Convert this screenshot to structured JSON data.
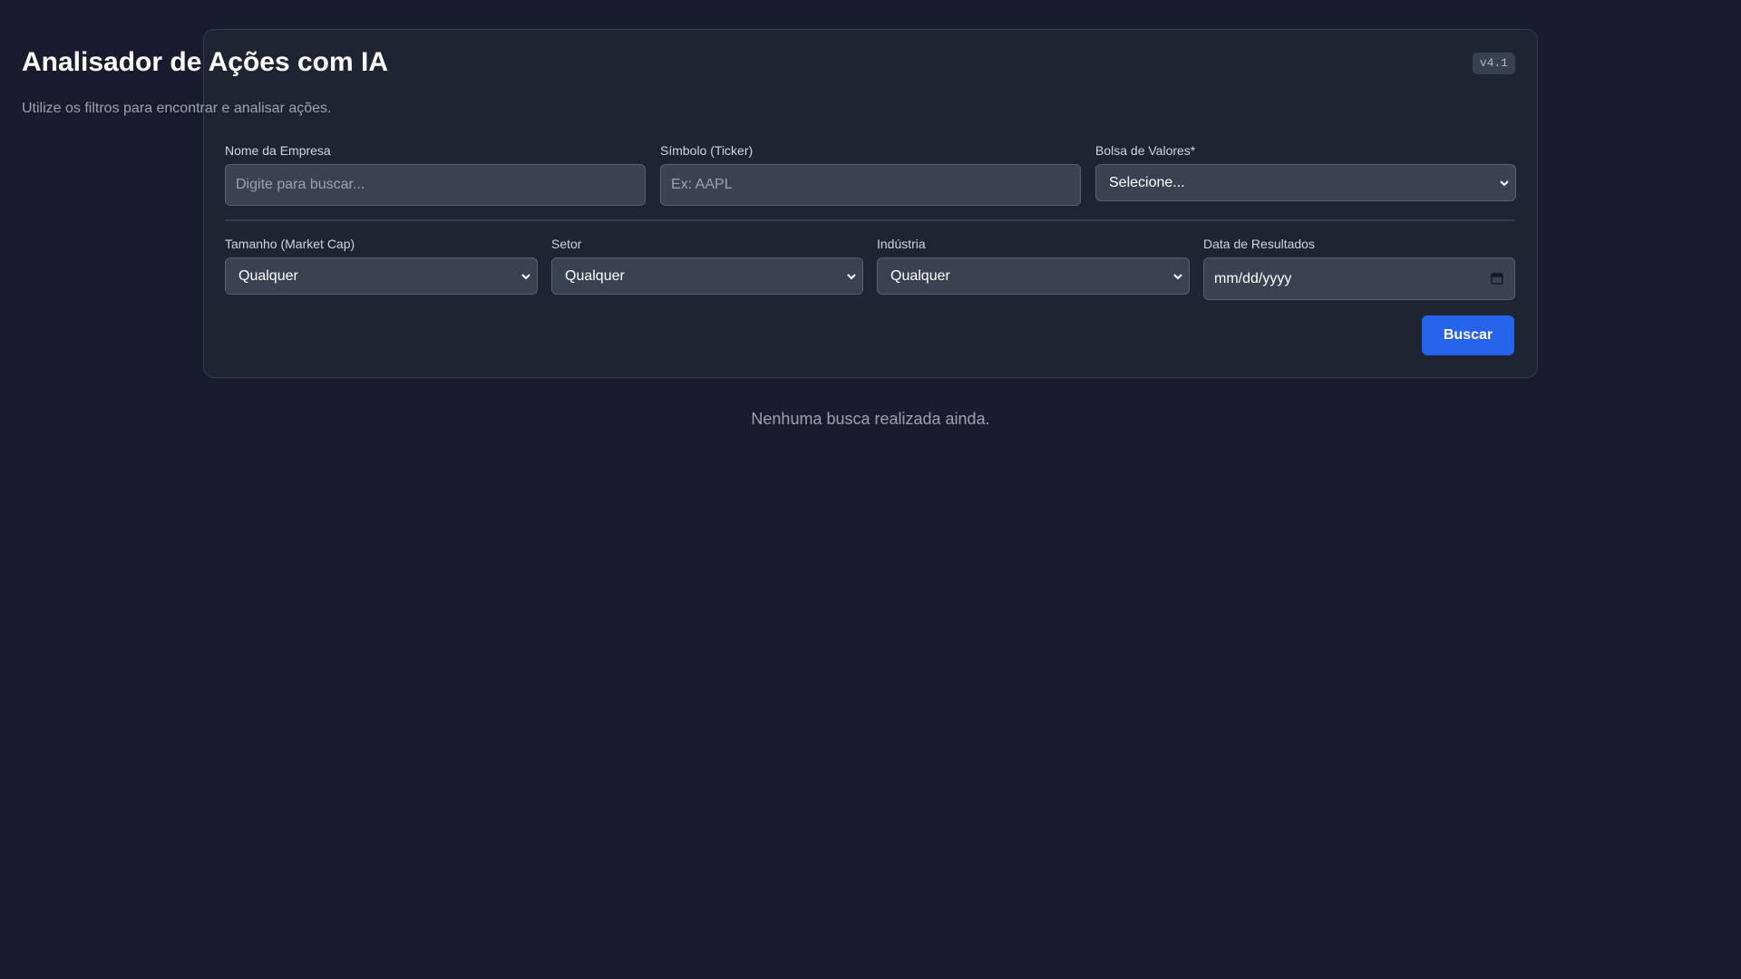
{
  "header": {
    "title": "Analisador de Ações com IA",
    "subtitle": "Utilize os filtros para encontrar e analisar ações.",
    "version": "v4.1"
  },
  "filters": {
    "company_name": {
      "label": "Nome da Empresa",
      "placeholder": "Digite para buscar...",
      "value": ""
    },
    "ticker": {
      "label": "Símbolo (Ticker)",
      "placeholder": "Ex: AAPL",
      "value": ""
    },
    "exchange": {
      "label": "Bolsa de Valores*",
      "selected": "Selecione..."
    },
    "market_cap": {
      "label": "Tamanho (Market Cap)",
      "selected": "Qualquer"
    },
    "sector": {
      "label": "Setor",
      "selected": "Qualquer"
    },
    "industry": {
      "label": "Indústria",
      "selected": "Qualquer"
    },
    "results_date": {
      "label": "Data de Resultados",
      "value": "mm/dd/yyyy"
    }
  },
  "actions": {
    "search_label": "Buscar"
  },
  "results": {
    "empty_message": "Nenhuma busca realizada ainda."
  },
  "colors": {
    "background": "#1a1b2e",
    "panel": "#1f2433",
    "input": "#3a4150",
    "accent": "#2563eb"
  }
}
